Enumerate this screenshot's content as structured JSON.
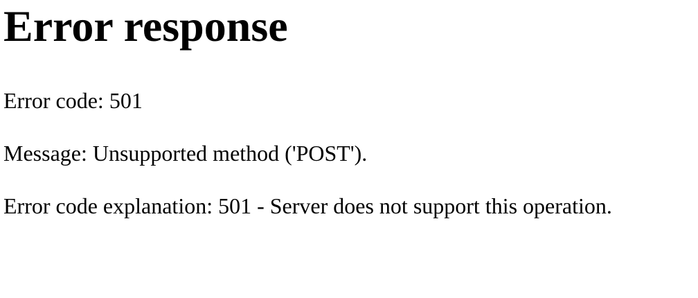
{
  "page": {
    "title": "Error response",
    "error_code_line": "Error code: 501",
    "message_line": "Message: Unsupported method ('POST').",
    "explanation_line": "Error code explanation: 501 - Server does not support this operation."
  }
}
